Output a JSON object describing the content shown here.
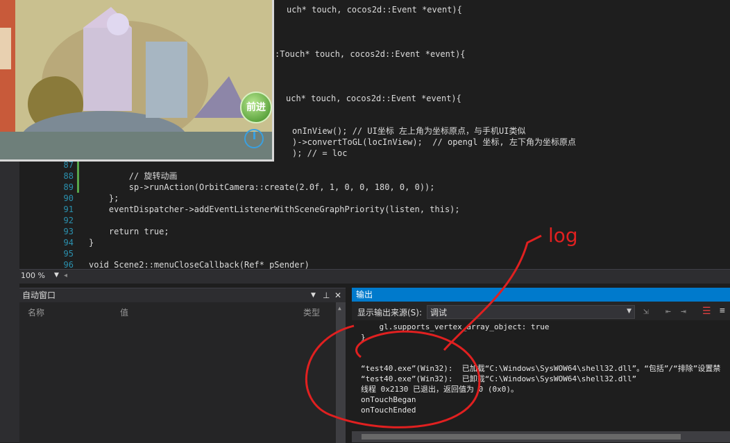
{
  "editor": {
    "lines_top": [
      {
        "text": "uch* touch, cocos2d::Event *event){"
      },
      {
        "text": ":Touch* touch, cocos2d::Event *event){"
      },
      {
        "text": "uch* touch, cocos2d::Event *event){"
      },
      {
        "text": "onInView(); // UI坐标 左上角为坐标原点，与手机UI类似"
      },
      {
        "text": ")->convertToGL(locInView);  // opengl 坐标, 左下角为坐标原点"
      },
      {
        "text": "); // = loc"
      }
    ],
    "numbered_lines": [
      {
        "num": "87",
        "text": ""
      },
      {
        "num": "88",
        "text": "        // 旋转动画"
      },
      {
        "num": "89",
        "text": "        sp->runAction(OrbitCamera::create(2.0f, 1, 0, 0, 180, 0, 0));"
      },
      {
        "num": "90",
        "text": "    };"
      },
      {
        "num": "91",
        "text": "    eventDispatcher->addEventListenerWithSceneGraphPriority(listen, this);"
      },
      {
        "num": "92",
        "text": ""
      },
      {
        "num": "93",
        "text": "    return true;"
      },
      {
        "num": "94",
        "text": "}"
      },
      {
        "num": "95",
        "text": ""
      },
      {
        "num": "96",
        "text": "void Scene2::menuCloseCallback(Ref* pSender)"
      }
    ],
    "zoom": "100 %"
  },
  "game": {
    "forward_button": "前进"
  },
  "autos": {
    "title": "自动窗口",
    "columns": [
      "名称",
      "值",
      "类型"
    ]
  },
  "output": {
    "title": "输出",
    "source_label": "显示输出来源(S):",
    "source_value": "调试",
    "lines": [
      "    gl.supports_vertex_array_object: true",
      "}",
      "",
      "",
      "“test40.exe”(Win32):  已加载“C:\\Windows\\SysWOW64\\shell32.dll”。“包括”/“排除”设置禁",
      "“test40.exe”(Win32):  已卸载“C:\\Windows\\SysWOW64\\shell32.dll”",
      "线程 0x2130 已退出，返回值为 0 (0x0)。",
      "onTouchBegan",
      "onTouchEnded"
    ]
  },
  "annotation": {
    "label": "log",
    "color": "#e02020"
  }
}
